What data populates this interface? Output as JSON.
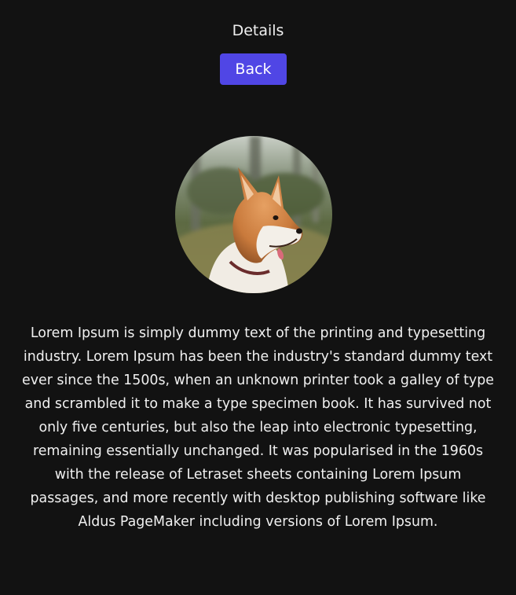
{
  "header": {
    "title": "Details"
  },
  "actions": {
    "back_label": "Back"
  },
  "image": {
    "subject": "corgi-dog-photo"
  },
  "content": {
    "description": "Lorem Ipsum is simply dummy text of the printing and typesetting industry. Lorem Ipsum has been the industry's standard dummy text ever since the 1500s, when an unknown printer took a galley of type and scrambled it to make a type specimen book. It has survived not only five centuries, but also the leap into electronic typesetting, remaining essentially unchanged. It was popularised in the 1960s with the release of Letraset sheets containing Lorem Ipsum passages, and more recently with desktop publishing software like Aldus PageMaker including versions of Lorem Ipsum."
  },
  "colors": {
    "background": "#121212",
    "accent": "#5046e5",
    "text": "#f0f0f0"
  }
}
